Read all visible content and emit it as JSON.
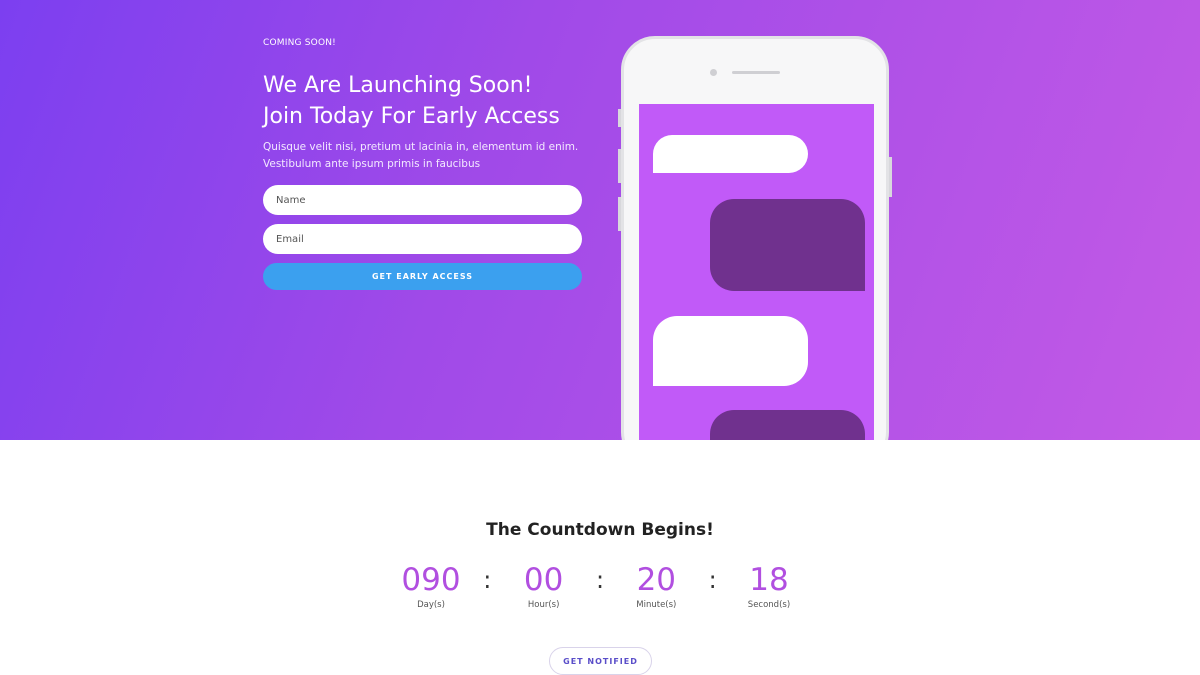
{
  "hero": {
    "kicker": "COMING SOON!",
    "headline_line1": "We Are Launching Soon!",
    "headline_line2": "Join Today For Early Access",
    "subtext_line1": "Quisque velit nisi, pretium ut lacinia in, elementum id enim.",
    "subtext_line2": "Vestibulum ante ipsum primis in faucibus",
    "form": {
      "name_placeholder": "Name",
      "email_placeholder": "Email",
      "submit_label": "GET EARLY ACCESS"
    }
  },
  "countdown": {
    "title": "The Countdown Begins!",
    "units": [
      {
        "value": "090",
        "label": "Day(s)"
      },
      {
        "value": "00",
        "label": "Hour(s)"
      },
      {
        "value": "20",
        "label": "Minute(s)"
      },
      {
        "value": "18",
        "label": "Second(s)"
      }
    ],
    "separator": ":",
    "notify_label": "GET NOTIFIED"
  },
  "colors": {
    "gradient_start": "#7c3ff0",
    "gradient_end": "#c35ae6",
    "cta_blue": "#3ba0ef",
    "countdown_purple": "#b14fe0",
    "phone_screen": "#c15af8",
    "bubble_dark": "#70318e"
  }
}
